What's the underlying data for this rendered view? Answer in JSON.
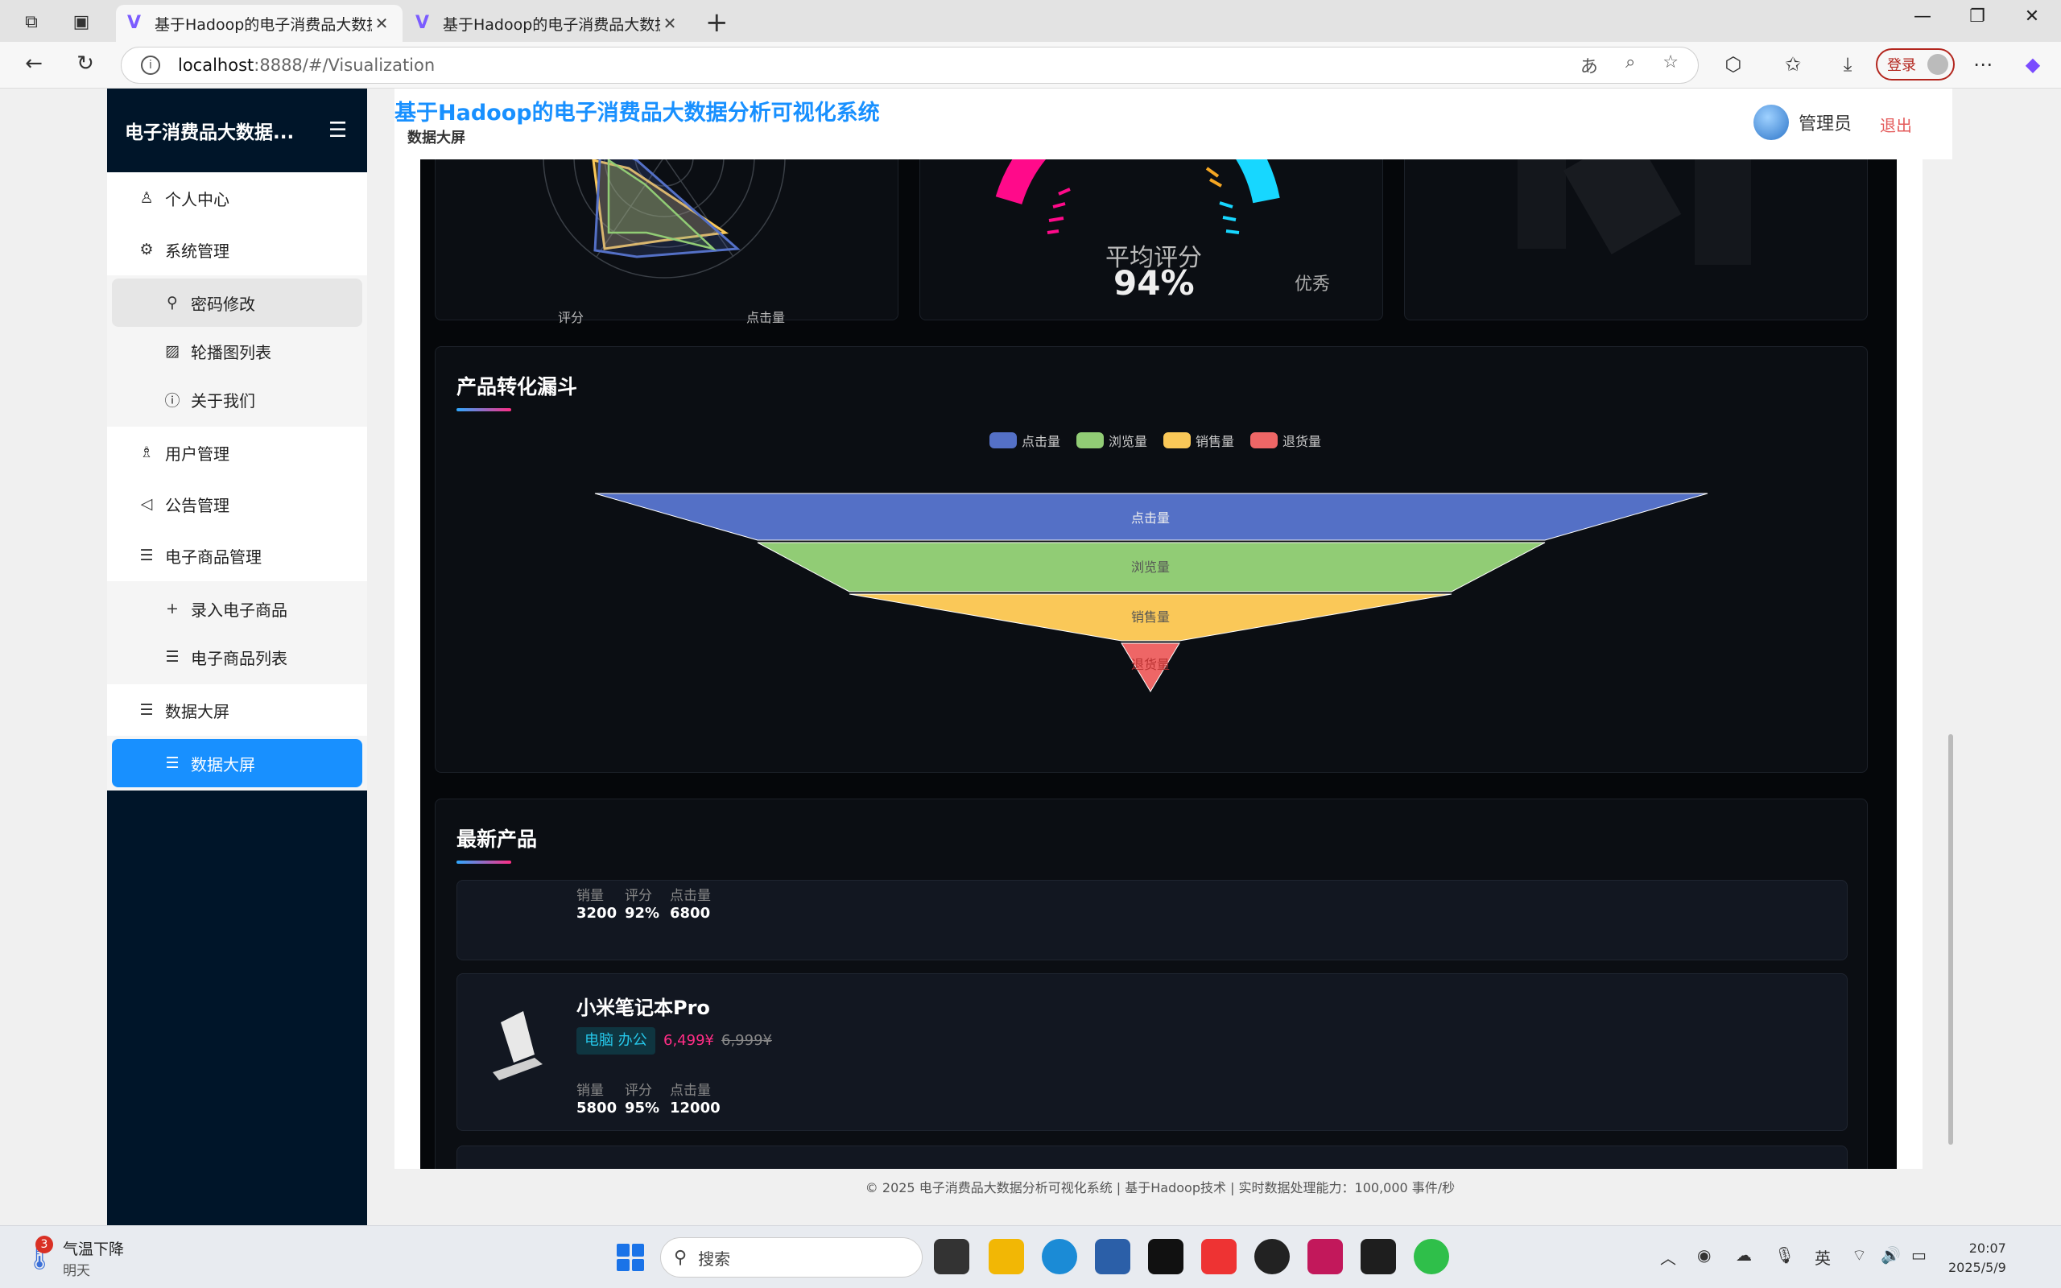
{
  "browser": {
    "tabs": [
      {
        "title": "基于Hadoop的电子消费品大数据分",
        "active": true
      },
      {
        "title": "基于Hadoop的电子消费品大数据分",
        "active": false
      }
    ],
    "url_host": "localhost",
    "url_rest": ":8888/#/Visualization",
    "login_label": "登录"
  },
  "sidebar": {
    "title": "电子消费品大数据...",
    "items": [
      {
        "label": "个人中心",
        "icon": "user-icon"
      },
      {
        "label": "系统管理",
        "icon": "gear-icon"
      },
      {
        "label": "密码修改",
        "icon": "key-icon"
      },
      {
        "label": "轮播图列表",
        "icon": "image-icon"
      },
      {
        "label": "关于我们",
        "icon": "info-icon"
      },
      {
        "label": "用户管理",
        "icon": "users-icon"
      },
      {
        "label": "公告管理",
        "icon": "megaphone-icon"
      },
      {
        "label": "电子商品管理",
        "icon": "list-icon"
      },
      {
        "label": "录入电子商品",
        "icon": "plus-icon"
      },
      {
        "label": "电子商品列表",
        "icon": "list-icon"
      },
      {
        "label": "数据大屏",
        "icon": "list-icon"
      },
      {
        "label": "数据大屏",
        "icon": "list-icon"
      }
    ]
  },
  "header": {
    "title": "基于Hadoop的电子消费品大数据分析可视化系统",
    "breadcrumb": "数据大屏",
    "user": "管理员",
    "logout": "退出"
  },
  "top_cards": {
    "radar_labels": [
      "评分",
      "点击量"
    ],
    "gauge_label": "平均评分",
    "gauge_value": "94%",
    "gauge_rating": "优秀",
    "gauge_percent": 94
  },
  "funnel": {
    "title": "产品转化漏斗",
    "legend": [
      {
        "name": "点击量",
        "color": "#5470c6"
      },
      {
        "name": "浏览量",
        "color": "#91cc75"
      },
      {
        "name": "销售量",
        "color": "#fac858"
      },
      {
        "name": "退货量",
        "color": "#ee6666"
      }
    ]
  },
  "latest": {
    "title": "最新产品",
    "stat_labels": [
      "销量",
      "评分",
      "点击量"
    ],
    "partial_product": {
      "sales": "3200",
      "rating": "92%",
      "clicks": "6800"
    },
    "product": {
      "name": "小米笔记本Pro",
      "tag": "电脑 办公",
      "price": "6,499¥",
      "original_price": "6,999¥",
      "sales": "5800",
      "rating": "95%",
      "clicks": "12000"
    }
  },
  "footer": "© 2025 电子消费品大数据分析可视化系统 | 基于Hadoop技术 | 实时数据处理能力：100,000 事件/秒",
  "taskbar": {
    "weather_badge": "3",
    "weather_title": "气温下降",
    "weather_sub": "明天",
    "search_placeholder": "搜索",
    "ime": "英",
    "time": "20:07",
    "date": "2025/5/9"
  }
}
